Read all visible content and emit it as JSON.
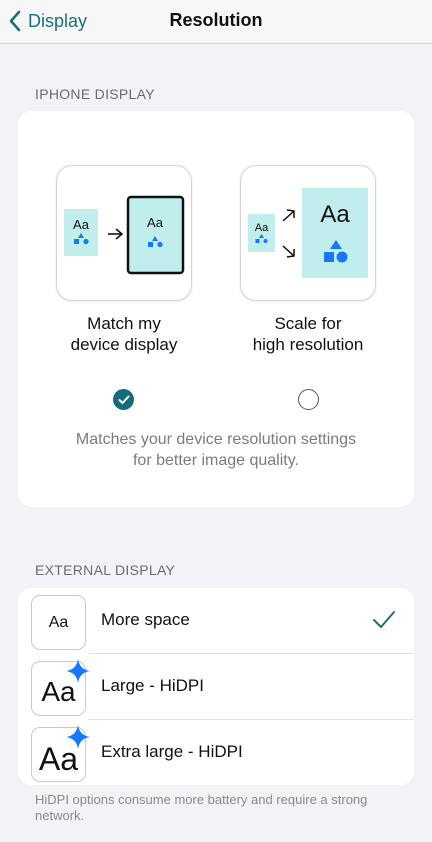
{
  "nav": {
    "back_label": "Display",
    "title": "Resolution"
  },
  "iphone_section": {
    "header": "IPHONE DISPLAY",
    "options": [
      {
        "label_line1": "Match my",
        "label_line2": "device display",
        "selected": true
      },
      {
        "label_line1": "Scale for",
        "label_line2": "high resolution",
        "selected": false
      }
    ],
    "tile_text": "Aa",
    "description_line1": "Matches your device resolution settings",
    "description_line2": "for better image quality."
  },
  "external_section": {
    "header": "EXTERNAL DISPLAY",
    "rows": [
      {
        "icon_text": "Aa",
        "label": "More space",
        "selected": true
      },
      {
        "icon_text": "Aa",
        "label": "Large - HiDPI",
        "selected": false
      },
      {
        "icon_text": "Aa",
        "label": "Extra large - HiDPI",
        "selected": false
      }
    ],
    "footer": "HiDPI options consume more battery and require a strong network."
  },
  "colors": {
    "accent": "#1a6f7f",
    "tile_fill": "#bfeeec",
    "sparkle": "#1677ff"
  }
}
